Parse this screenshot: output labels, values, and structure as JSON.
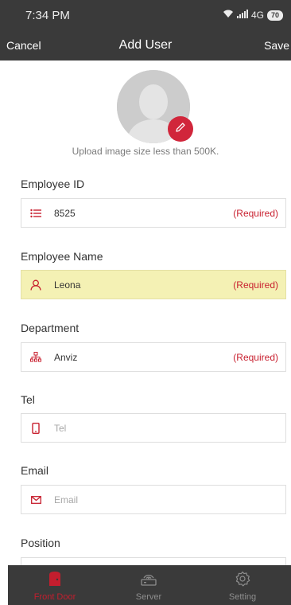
{
  "status_bar": {
    "time": "7:34 PM",
    "network": "4G",
    "battery": "70"
  },
  "nav": {
    "cancel_label": "Cancel",
    "title": "Add User",
    "save_label": "Save"
  },
  "avatar": {
    "upload_hint": "Upload image size less than 500K."
  },
  "fields": [
    {
      "label": "Employee ID",
      "value": "8525",
      "placeholder": "",
      "required_text": "(Required)",
      "icon": "list-icon",
      "highlighted": false
    },
    {
      "label": "Employee Name",
      "value": "Leona",
      "placeholder": "",
      "required_text": "(Required)",
      "icon": "person-icon",
      "highlighted": true
    },
    {
      "label": "Department",
      "value": "Anviz",
      "placeholder": "",
      "required_text": "(Required)",
      "icon": "org-chart-icon",
      "highlighted": false
    },
    {
      "label": "Tel",
      "value": "",
      "placeholder": "Tel",
      "required_text": "",
      "icon": "phone-icon",
      "highlighted": false
    },
    {
      "label": "Email",
      "value": "",
      "placeholder": "Email",
      "required_text": "",
      "icon": "mail-icon",
      "highlighted": false
    },
    {
      "label": "Position",
      "value": "",
      "placeholder": "",
      "required_text": "",
      "icon": "",
      "highlighted": false
    }
  ],
  "tabs": [
    {
      "label": "Front Door",
      "icon": "door-icon",
      "active": true
    },
    {
      "label": "Server",
      "icon": "server-icon",
      "active": false
    },
    {
      "label": "Setting",
      "icon": "gear-icon",
      "active": false
    }
  ],
  "colors": {
    "accent": "#c8202f",
    "header_bg": "#3a3a3a",
    "highlight_bg": "#f4f1b4"
  }
}
